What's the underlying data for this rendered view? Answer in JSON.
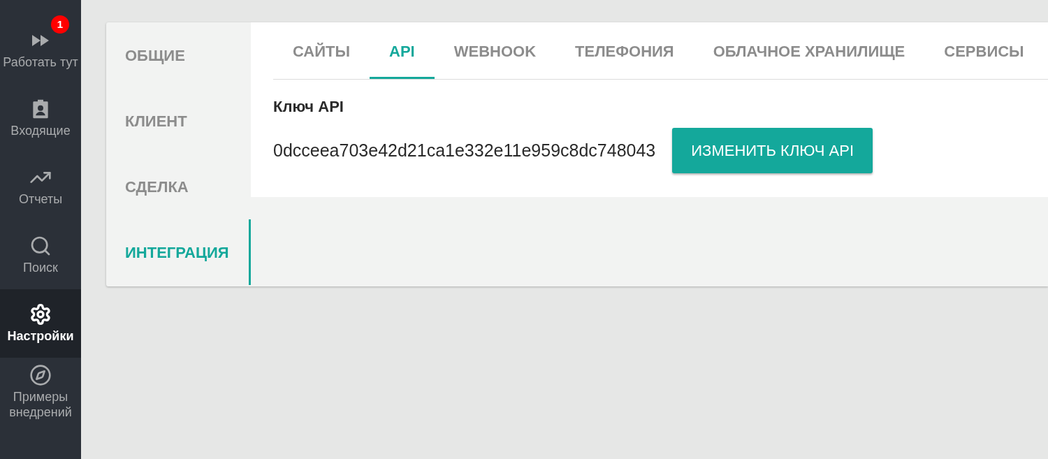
{
  "sidebar": {
    "items": [
      {
        "kind": "fast-forward",
        "label": "Работать тут",
        "badge": "1",
        "selected": false
      },
      {
        "kind": "badge",
        "label": "Входящие",
        "selected": false
      },
      {
        "kind": "trend",
        "label": "Отчеты",
        "selected": false
      },
      {
        "kind": "search",
        "label": "Поиск",
        "selected": false
      },
      {
        "kind": "gear",
        "label": "Настройки",
        "selected": true
      },
      {
        "kind": "compass",
        "label": "Примеры внедрений",
        "selected": false
      }
    ]
  },
  "section_tabs": [
    {
      "label": "ОБЩИЕ",
      "selected": false
    },
    {
      "label": "КЛИЕНТ",
      "selected": false
    },
    {
      "label": "СДЕЛКА",
      "selected": false
    },
    {
      "label": "ИНТЕГРАЦИЯ",
      "selected": true
    }
  ],
  "tabs": [
    {
      "label": "САЙТЫ",
      "selected": false
    },
    {
      "label": "API",
      "selected": true
    },
    {
      "label": "WEBHOOK",
      "selected": false
    },
    {
      "label": "ТЕЛЕФОНИЯ",
      "selected": false
    },
    {
      "label": "ОБЛАЧНОЕ ХРАНИЛИЩЕ",
      "selected": false
    },
    {
      "label": "СЕРВИСЫ",
      "selected": false
    }
  ],
  "api_key": {
    "title": "Ключ API",
    "value": "0dcceea703e42d21ca1e332e11e959c8dc748043",
    "button": "ИЗМЕНИТЬ КЛЮЧ API"
  }
}
